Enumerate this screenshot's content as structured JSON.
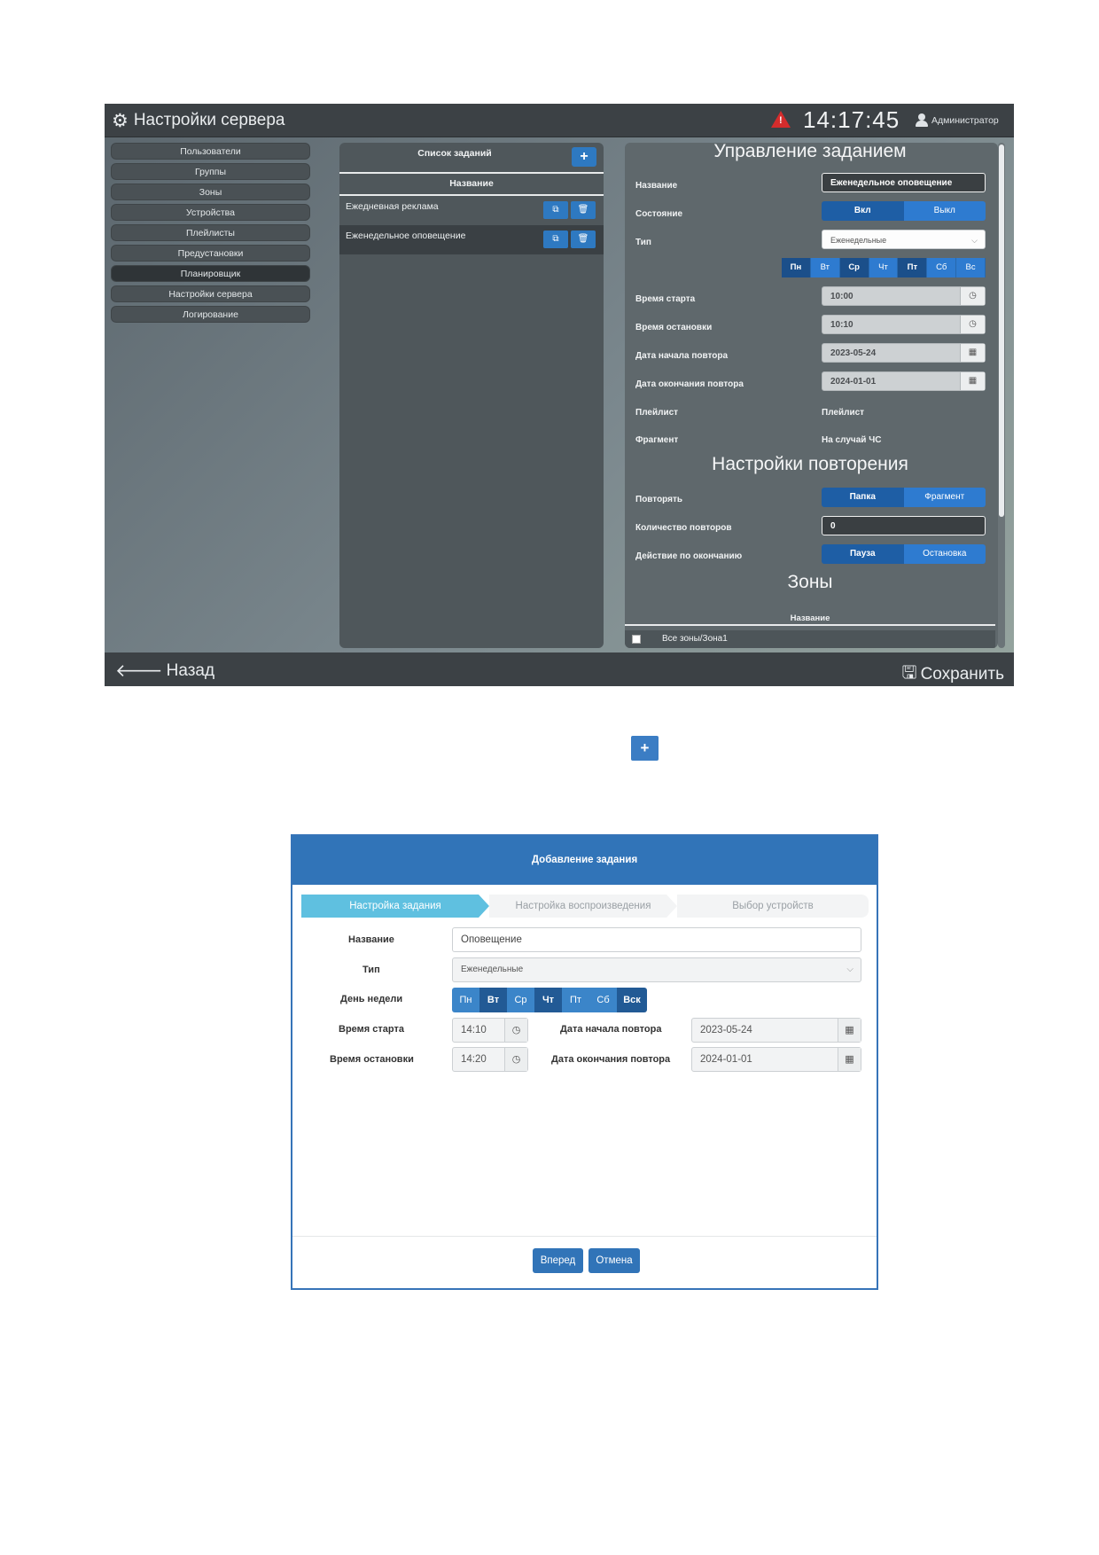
{
  "app": {
    "title": "Настройки сервера",
    "clock": "14:17:45",
    "user": "Администратор",
    "nav": [
      "Пользователи",
      "Группы",
      "Зоны",
      "Устройства",
      "Плейлисты",
      "Предустановки",
      "Планировщик",
      "Настройки сервера",
      "Логирование"
    ],
    "active_nav": "Планировщик"
  },
  "task_list": {
    "title": "Список заданий",
    "add_label": "+",
    "column": "Название",
    "rows": [
      "Ежедневная реклама",
      "Еженедельное оповещение"
    ]
  },
  "manage": {
    "title": "Управление заданием",
    "labels": {
      "name": "Название",
      "state": "Состояние",
      "type": "Тип",
      "start": "Время старта",
      "stop": "Время остановки",
      "repeat_start": "Дата начала повтора",
      "repeat_end": "Дата окончания повтора",
      "playlist": "Плейлист",
      "fragment": "Фрагмент"
    },
    "name_value": "Еженедельное оповещение",
    "state_on": "Вкл",
    "state_off": "Выкл",
    "type_value": "Еженедельные",
    "days": [
      "Пн",
      "Вт",
      "Ср",
      "Чт",
      "Пт",
      "Сб",
      "Вс"
    ],
    "start_time": "10:00",
    "stop_time": "10:10",
    "repeat_start_date": "2023-05-24",
    "repeat_end_date": "2024-01-01",
    "playlist_value": "Плейлист",
    "fragment_value": "На случай ЧС",
    "repeat_section": {
      "title": "Настройки повторения",
      "repeat_label": "Повторять",
      "repeat_opt1": "Папка",
      "repeat_opt2": "Фрагмент",
      "count_label": "Количество повторов",
      "count_value": "0",
      "end_action_label": "Действие по окончанию",
      "end_opt1": "Пауза",
      "end_opt2": "Остановка"
    },
    "zones": {
      "title": "Зоны",
      "column": "Название",
      "row": "Все зоны/Зона1"
    }
  },
  "bottom": {
    "back": "Назад",
    "save": "Сохранить"
  },
  "standalone_plus": "+",
  "dialog": {
    "title": "Добавление задания",
    "steps": [
      "Настройка задания",
      "Настройка воспроизведения",
      "Выбор устройств"
    ],
    "labels": {
      "name": "Название",
      "type": "Тип",
      "weekday": "День недели",
      "start": "Время старта",
      "stop": "Время остановки",
      "repeat_start": "Дата начала повтора",
      "repeat_end": "Дата окончания повтора"
    },
    "name_value": "Оповещение",
    "type_value": "Еженедельные",
    "days": [
      "Пн",
      "Вт",
      "Ср",
      "Чт",
      "Пт",
      "Сб",
      "Вск"
    ],
    "start_time": "14:10",
    "stop_time": "14:20",
    "repeat_start_date": "2023-05-24",
    "repeat_end_date": "2024-01-01",
    "next": "Вперед",
    "cancel": "Отмена"
  },
  "colors": {
    "accent": "#2e7bd0",
    "dialog_header": "#3174b8",
    "step_active": "#5fc0e0",
    "alert": "#d42c2c"
  },
  "icons": [
    "gears-icon",
    "warning-icon",
    "user-icon",
    "plus-icon",
    "copy-icon",
    "trash-icon",
    "clock-icon",
    "calendar-icon",
    "chevron-down-icon",
    "arrow-left-icon",
    "floppy-icon",
    "checkbox-icon"
  ]
}
